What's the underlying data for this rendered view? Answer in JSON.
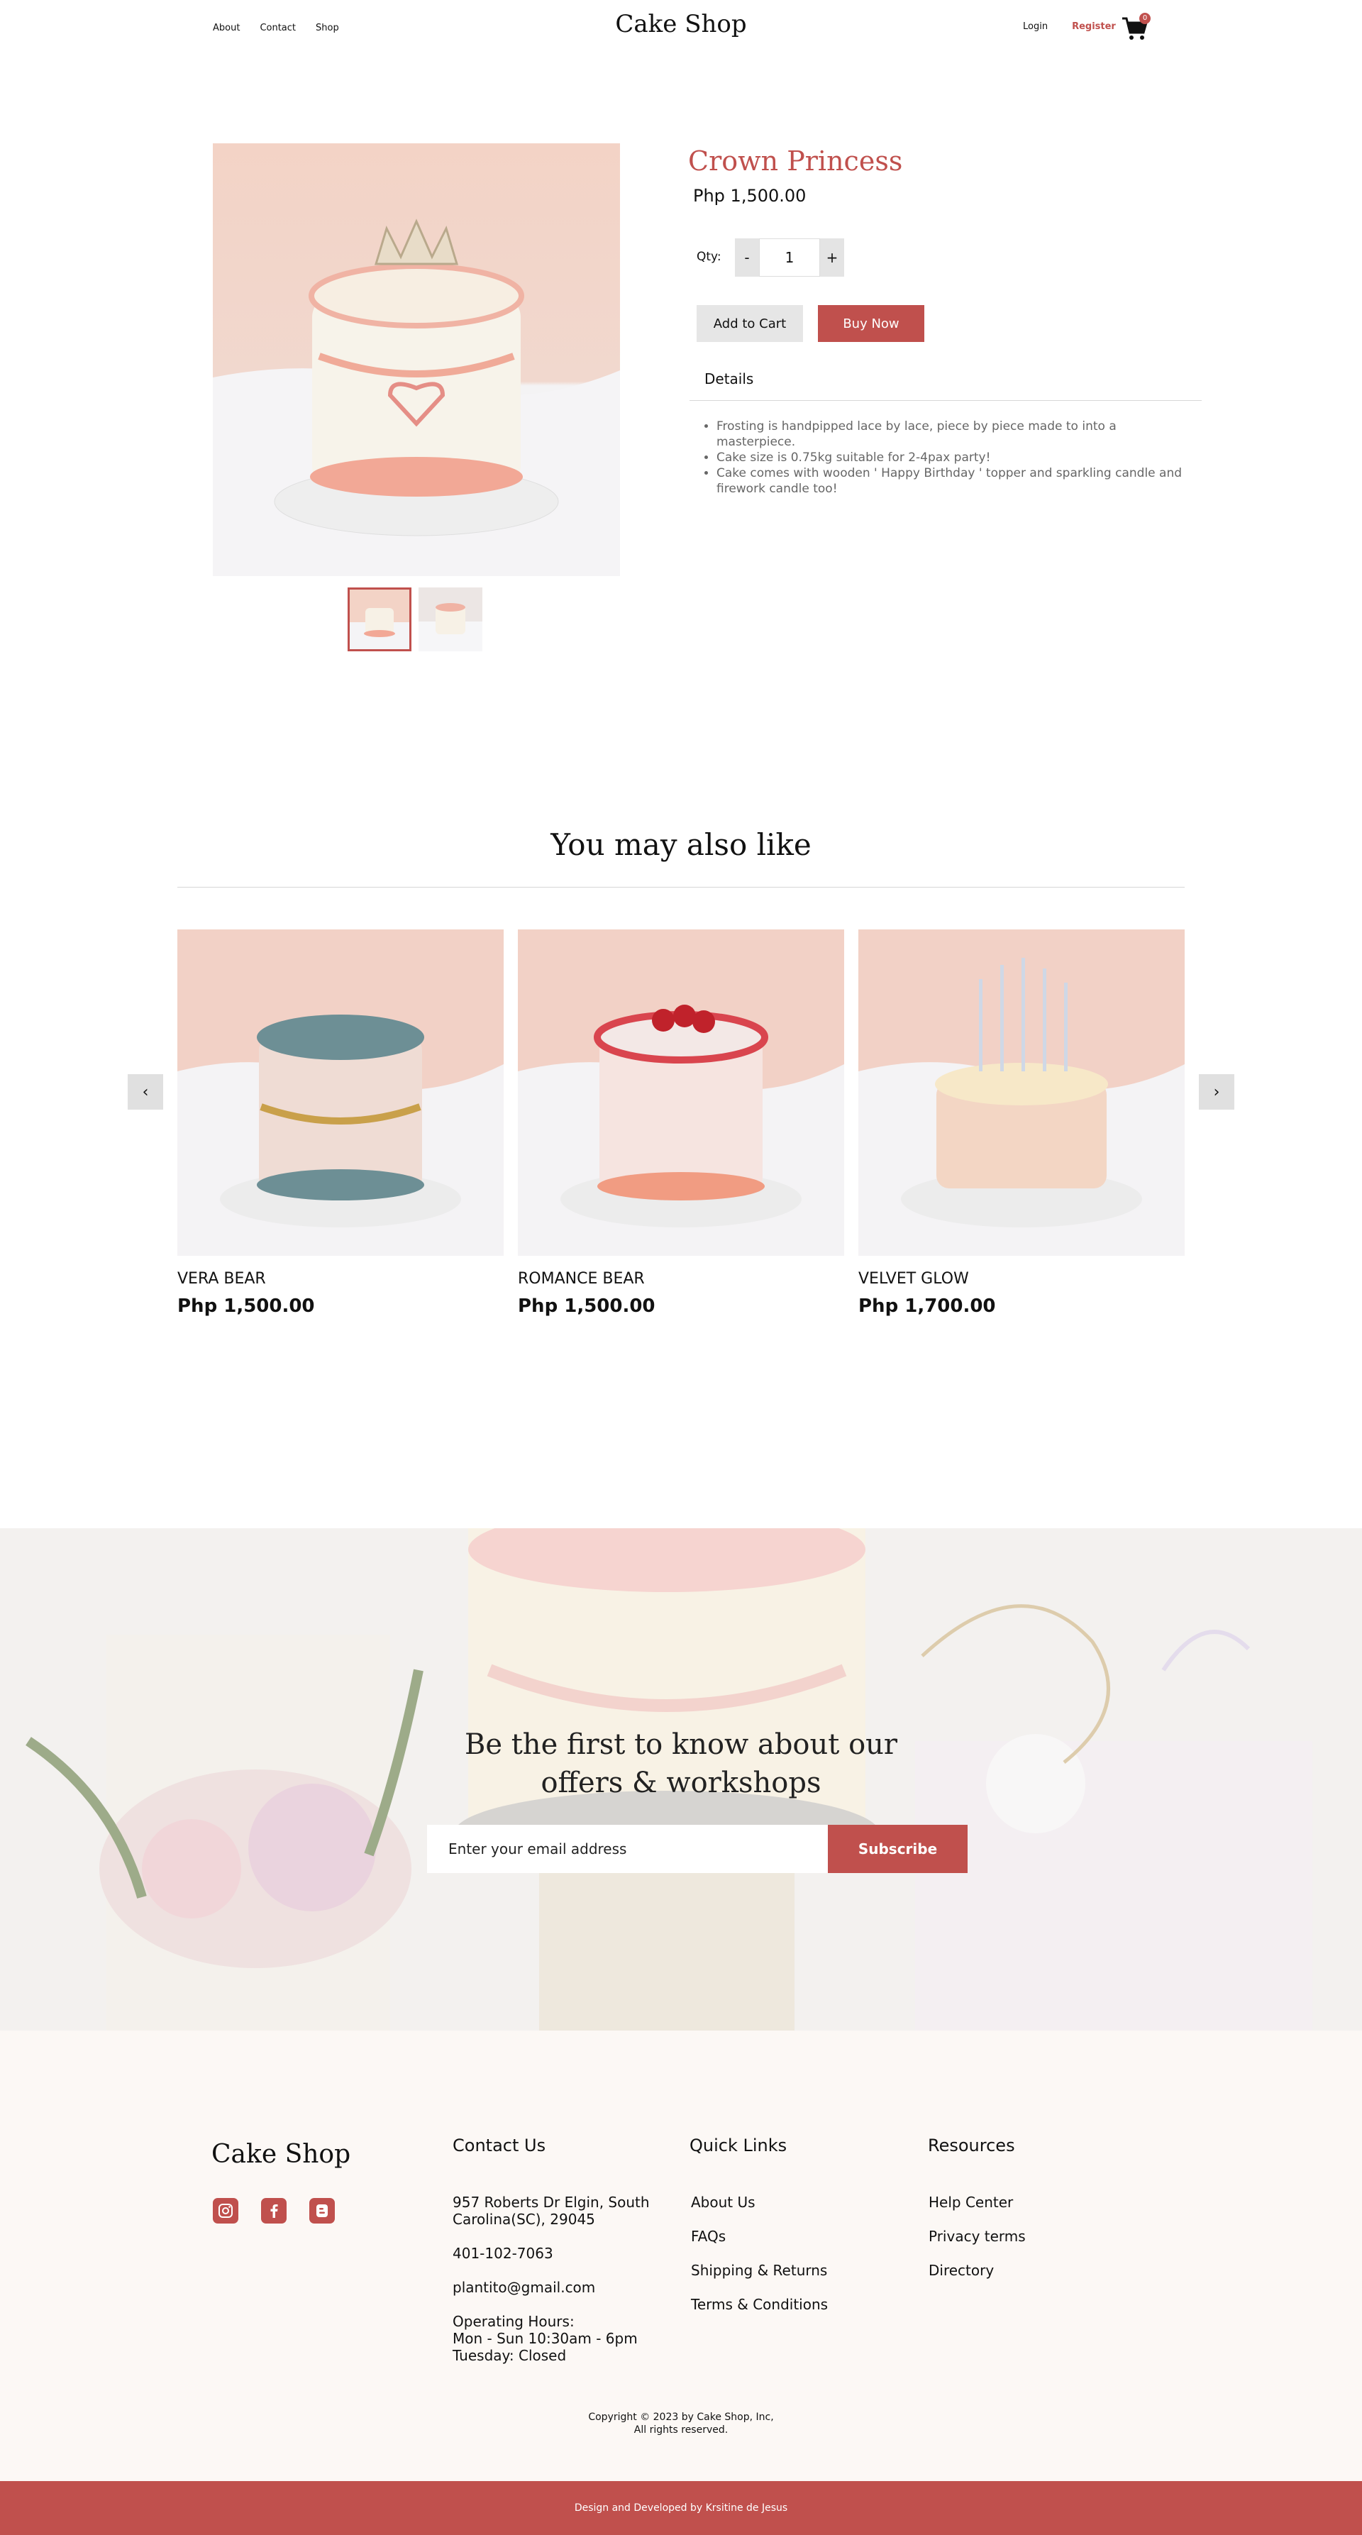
{
  "header": {
    "nav": [
      "About",
      "Contact",
      "Shop"
    ],
    "logo": "Cake Shop",
    "login": "Login",
    "register": "Register",
    "cart_count": "0"
  },
  "product": {
    "name": "Crown Princess",
    "price": "Php 1,500.00",
    "qty_label": "Qty:",
    "qty_minus": "-",
    "qty_value": "1",
    "qty_plus": "+",
    "add_to_cart": "Add to Cart",
    "buy_now": "Buy Now",
    "details_heading": "Details",
    "details": [
      "Frosting is handpipped lace by lace, piece by piece made to into a masterpiece.",
      "Cake size is 0.75kg suitable for 2-4pax party!",
      "Cake comes with wooden ' Happy Birthday ' topper and sparkling candle and firework candle too!"
    ]
  },
  "related": {
    "title": "You may also like",
    "prev": "‹",
    "next": "›",
    "items": [
      {
        "name": "VERA BEAR",
        "price": "Php 1,500.00"
      },
      {
        "name": "ROMANCE BEAR",
        "price": "Php 1,500.00"
      },
      {
        "name": "VELVET GLOW",
        "price": "Php 1,700.00"
      }
    ]
  },
  "newsletter": {
    "title_line1": "Be the first to know about our",
    "title_line2": "offers & workshops",
    "placeholder": "Enter your email address",
    "button": "Subscribe"
  },
  "footer": {
    "logo": "Cake Shop",
    "social_icons": [
      "instagram-icon",
      "facebook-icon",
      "blogger-icon"
    ],
    "contact": {
      "heading": "Contact Us",
      "address_line1": "957 Roberts Dr Elgin, South",
      "address_line2": "Carolina(SC), 29045",
      "phone": "401-102-7063",
      "email": "plantito@gmail.com",
      "hours_line1": "Operating Hours:",
      "hours_line2": "Mon - Sun 10:30am - 6pm",
      "hours_line3": "Tuesday: Closed"
    },
    "quick_links": {
      "heading": "Quick Links",
      "links": [
        "About Us",
        "FAQs",
        "Shipping & Returns",
        "Terms & Conditions"
      ]
    },
    "resources": {
      "heading": "Resources",
      "links": [
        "Help Center",
        "Privacy terms",
        "Directory"
      ]
    },
    "copyright_line1": "Copyright © 2023 by Cake Shop, Inc,",
    "copyright_line2": "All rights reserved.",
    "credits": "Design and Developed by Krsitine de Jesus"
  },
  "colors": {
    "accent": "#c0504d",
    "footer_bg": "#fcf8f5",
    "cake_bg": "#f2d4c8"
  }
}
